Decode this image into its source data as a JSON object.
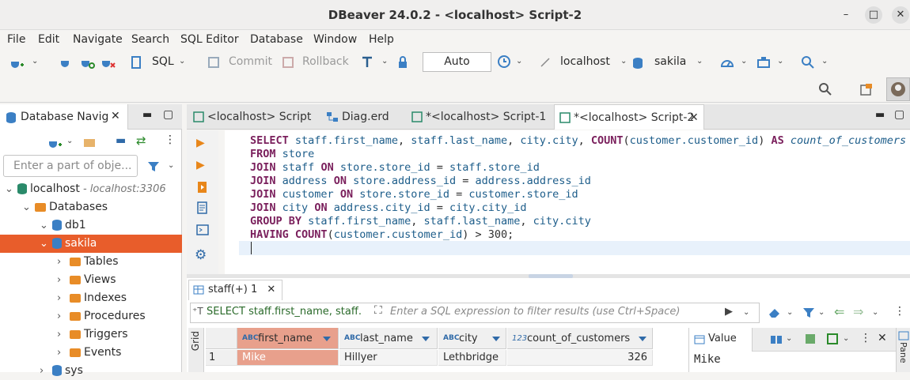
{
  "window": {
    "title": "DBeaver 24.0.2 - <localhost> Script-2",
    "min": "–",
    "max": "□",
    "close": "✕"
  },
  "menu": [
    "File",
    "Edit",
    "Navigate",
    "Search",
    "SQL Editor",
    "Database",
    "Window",
    "Help"
  ],
  "toolbar": {
    "sql_label": "SQL",
    "commit_label": "Commit",
    "rollback_label": "Rollback",
    "transaction_mode": "Auto",
    "connection": "localhost",
    "schema": "sakila"
  },
  "navigator": {
    "title": "Database Navig",
    "filter_placeholder": "Enter a part of obje...",
    "tree": [
      {
        "label": "localhost",
        "hint": " - localhost:3306",
        "level": 0,
        "type": "server"
      },
      {
        "label": "Databases",
        "level": 1,
        "type": "folder"
      },
      {
        "label": "db1",
        "level": 2,
        "type": "db"
      },
      {
        "label": "sakila",
        "level": 2,
        "type": "db",
        "selected": true
      },
      {
        "label": "Tables",
        "level": 3,
        "type": "folder"
      },
      {
        "label": "Views",
        "level": 3,
        "type": "folder"
      },
      {
        "label": "Indexes",
        "level": 3,
        "type": "folder"
      },
      {
        "label": "Procedures",
        "level": 3,
        "type": "folder"
      },
      {
        "label": "Triggers",
        "level": 3,
        "type": "folder"
      },
      {
        "label": "Events",
        "level": 3,
        "type": "folder"
      },
      {
        "label": "sys",
        "level": 2,
        "type": "db"
      }
    ]
  },
  "editor_tabs": [
    {
      "label": "<localhost> Script"
    },
    {
      "label": "Diag.erd"
    },
    {
      "label": "*<localhost> Script-1"
    },
    {
      "label": "*<localhost> Script-2",
      "active": true
    }
  ],
  "sql_lines": [
    "SELECT staff.first_name, staff.last_name, city.city, COUNT(customer.customer_id) AS count_of_customers",
    "FROM store",
    "JOIN staff ON store.store_id = staff.store_id",
    "JOIN address ON store.address_id = address.address_id",
    "JOIN customer ON store.store_id = customer.store_id",
    "JOIN city ON address.city_id = city.city_id",
    "GROUP BY staff.first_name, staff.last_name, city.city",
    "HAVING COUNT(customer.customer_id) > 300;"
  ],
  "results": {
    "tab_label": "staff(+) 1",
    "query_preview": "SELECT staff.first_name, staff.",
    "filter_placeholder": "Enter a SQL expression to filter results (use Ctrl+Space)",
    "grid_label": "Grid",
    "columns": [
      {
        "type": "ABC",
        "name": "first_name"
      },
      {
        "type": "ABC",
        "name": "last_name"
      },
      {
        "type": "ABC",
        "name": "city"
      },
      {
        "type": "123",
        "name": "count_of_customers"
      }
    ],
    "rows": [
      {
        "n": "1",
        "first_name": "Mike",
        "last_name": "Hillyer",
        "city": "Lethbridge",
        "count": "326"
      }
    ]
  },
  "value_panel": {
    "title": "Value",
    "value": "Mike",
    "side_label": "Pane"
  }
}
